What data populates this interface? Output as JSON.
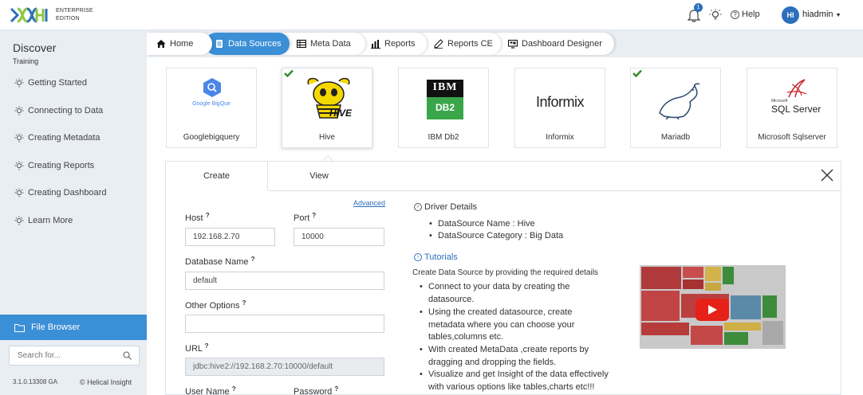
{
  "topbar": {
    "edition_line1": "ENTERPRISE",
    "edition_line2": "EDITION",
    "notification_count": "1",
    "help_label": "Help",
    "avatar_initials": "HI",
    "username": "hiadmin"
  },
  "sidebar": {
    "title": "Discover",
    "subtitle": "Training",
    "items": [
      {
        "label": "Getting Started"
      },
      {
        "label": "Connecting to Data"
      },
      {
        "label": "Creating Metadata"
      },
      {
        "label": "Creating Reports"
      },
      {
        "label": "Creating Dashboard"
      },
      {
        "label": "Learn More"
      }
    ],
    "file_browser_label": "File Browser",
    "search_placeholder": "Search for...",
    "version": "3.1.0.13308 GA",
    "copyright": "© Helical Insight"
  },
  "nav": {
    "tabs": [
      {
        "label": "Home"
      },
      {
        "label": "Data Sources"
      },
      {
        "label": "Meta Data"
      },
      {
        "label": "Reports"
      },
      {
        "label": "Reports CE"
      },
      {
        "label": "Dashboard Designer"
      }
    ],
    "active": "Data Sources"
  },
  "datasources": [
    {
      "label": "Googlebigquery",
      "logo_text": "Google BigQue",
      "checked": false
    },
    {
      "label": "Hive",
      "logo_text": "HIVE",
      "checked": true,
      "selected": true
    },
    {
      "label": "IBM Db2",
      "logo_text": "IBM DB2",
      "checked": false
    },
    {
      "label": "Informix",
      "logo_text": "Informix",
      "checked": false
    },
    {
      "label": "Mariadb",
      "checked": true
    },
    {
      "label": "Microsoft Sqlserver",
      "logo_text": "SQL Server",
      "logo_small": "Microsoft",
      "checked": false
    }
  ],
  "panel": {
    "tab_create": "Create",
    "tab_view": "View",
    "advanced_link": "Advanced",
    "host_label": "Host",
    "host_value": "192.168.2.70",
    "port_label": "Port",
    "port_value": "10000",
    "dbname_label": "Database Name",
    "dbname_value": "default",
    "other_options_label": "Other Options",
    "other_options_value": "",
    "url_label": "URL",
    "url_value": "jdbc:hive2://192.168.2.70:10000/default",
    "username_label": "User Name",
    "password_label": "Password"
  },
  "driver": {
    "heading": "Driver Details",
    "name_line": "DataSource Name : Hive",
    "category_line": "DataSource Category : Big Data"
  },
  "tutorials": {
    "heading": "Tutorials",
    "intro": "Create Data Source by providing the required details",
    "bullets": [
      [
        "Connect to your data by creating the",
        "datasource."
      ],
      [
        "Using the created datasource, create",
        "metadata where you can choose your",
        "tables,columns etc."
      ],
      [
        "With created MetaData ,create reports by",
        "dragging and dropping the fields."
      ],
      [
        "Visualize and get Insight of the data effectively",
        "with various options like tables,charts etc!!!"
      ]
    ]
  },
  "colors": {
    "accent": "#3b8fd6",
    "sidebar_bg": "#e9eef3",
    "check_green": "#2e8b2e",
    "play_red": "#e62117"
  }
}
